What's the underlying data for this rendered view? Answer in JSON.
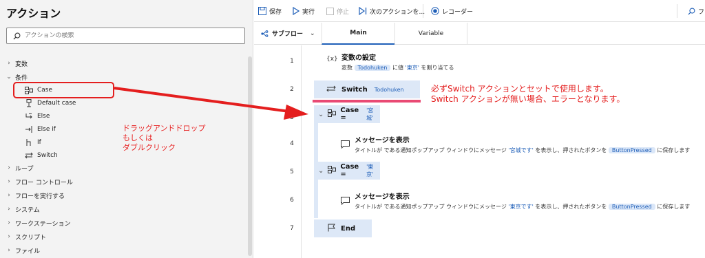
{
  "left_panel": {
    "title": "アクション",
    "search_placeholder": "アクションの検索",
    "groups": [
      {
        "label": "変数",
        "expanded": false
      },
      {
        "label": "条件",
        "expanded": true
      },
      {
        "label": "ループ",
        "expanded": false
      },
      {
        "label": "フロー コントロール",
        "expanded": false
      },
      {
        "label": "フローを実行する",
        "expanded": false
      },
      {
        "label": "システム",
        "expanded": false
      },
      {
        "label": "ワークステーション",
        "expanded": false
      },
      {
        "label": "スクリプト",
        "expanded": false
      },
      {
        "label": "ファイル",
        "expanded": false
      }
    ],
    "condition_items": [
      {
        "label": "Case",
        "icon": "case-icon"
      },
      {
        "label": "Default case",
        "icon": "default-case-icon"
      },
      {
        "label": "Else",
        "icon": "else-icon"
      },
      {
        "label": "Else if",
        "icon": "else-if-icon"
      },
      {
        "label": "If",
        "icon": "if-icon"
      },
      {
        "label": "Switch",
        "icon": "switch-icon"
      }
    ]
  },
  "toolbar": {
    "save": "保存",
    "run": "実行",
    "stop": "停止",
    "next_action": "次のアクションを...",
    "recorder": "レコーダー",
    "search_partial": "フ"
  },
  "tabs": {
    "subflow": "サブフロー",
    "main": "Main",
    "variable": "Variable"
  },
  "flow": {
    "line_numbers": [
      "1",
      "2",
      "3",
      "4",
      "5",
      "6",
      "7"
    ],
    "step1": {
      "title": "変数の設定",
      "desc_prefix": "変数",
      "var": "Todohuken",
      "desc_mid": "に値",
      "value": "'東京'",
      "desc_suffix": "を割り当てる"
    },
    "step2": {
      "keyword": "Switch",
      "var": "Todohuken"
    },
    "step3": {
      "keyword": "Case =",
      "value": "'宮城'"
    },
    "step4": {
      "title": "メッセージを表示",
      "desc_prefix": "タイトルが  である通知ポップアップ ウィンドウにメッセージ",
      "message": "'宮城です'",
      "desc_mid": "を表示し、押されたボタンを",
      "var": "ButtonPressed",
      "desc_suffix": "に保存します"
    },
    "step5": {
      "keyword": "Case =",
      "value": "'東京'"
    },
    "step6": {
      "title": "メッセージを表示",
      "desc_prefix": "タイトルが  である通知ポップアップ ウィンドウにメッセージ",
      "message": "'東京です'",
      "desc_mid": "を表示し、押されたボタンを",
      "var": "ButtonPressed",
      "desc_suffix": "に保存します"
    },
    "step7": {
      "keyword": "End"
    }
  },
  "annotations": {
    "drag_note": [
      "ドラッグアンドドロップ",
      "もしくは",
      "ダブルクリック"
    ],
    "switch_note": [
      "必ずSwitch アクションとセットで使用します。",
      "Switch アクションが無い場合、エラーとなります。"
    ],
    "color": "#e41e1e"
  }
}
